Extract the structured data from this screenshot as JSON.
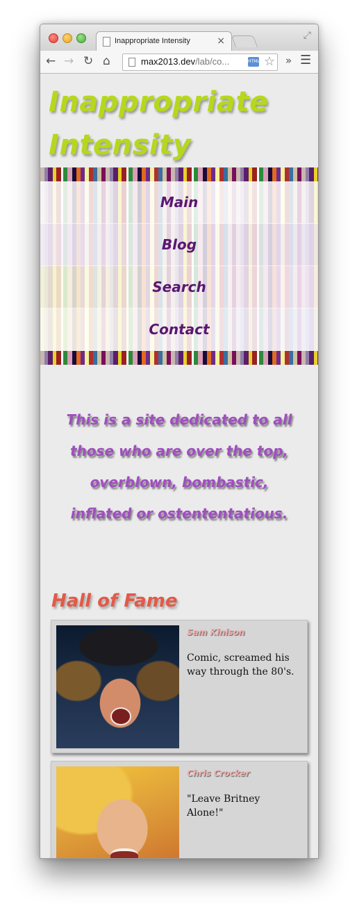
{
  "browser": {
    "tab_title": "Inappropriate Intensity",
    "tab_close": "×",
    "url_host": "max2013.dev",
    "url_path": "/lab/co...",
    "ext_label": "HTML",
    "back": "←",
    "forward": "→",
    "reload": "↻",
    "home": "⌂",
    "star": "☆",
    "overflow": "»",
    "menu": "☰",
    "fullscreen": "⤢"
  },
  "site": {
    "title": "Inappropriate Intensity",
    "nav": [
      "Main",
      "Blog",
      "Search",
      "Contact"
    ],
    "intro": "This is a site dedicated to all those who are over the top, overblown, bombastic, inflated or ostententatious.",
    "hall_of_fame_title": "Hall of Fame",
    "entries": [
      {
        "name": "Sam Kinison",
        "desc": "Comic, screamed his way through the 80's."
      },
      {
        "name": "Chris Crocker",
        "desc": "\"Leave Britney Alone!\""
      }
    ]
  },
  "colors": {
    "title": "#b5d81d",
    "nav_text": "#5a1670",
    "intro_text": "#a04ec0",
    "hof_title": "#e25a48",
    "card_bg": "#d6d6d6"
  }
}
